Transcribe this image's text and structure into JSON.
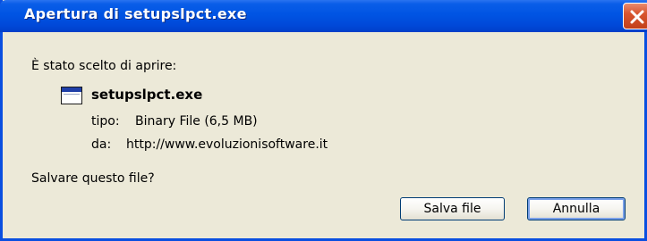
{
  "window": {
    "title": "Apertura di setupslpct.exe",
    "close_icon": "close-icon"
  },
  "dialog": {
    "prompt": "È stato scelto di aprire:",
    "file_icon": "executable-window-icon",
    "filename": "setupslpct.exe",
    "type_label": "tipo:",
    "type_value": "Binary File (6,5 MB)",
    "from_label": "da:",
    "from_value": "http://www.evoluzionisoftware.it",
    "question": "Salvare questo file?"
  },
  "buttons": {
    "save_label": "Salva file",
    "cancel_label": "Annulla"
  },
  "colors": {
    "titlebar": "#0054e3",
    "dialog_bg": "#ece9d8",
    "close_button": "#d8552f",
    "button_border": "#003c74"
  }
}
